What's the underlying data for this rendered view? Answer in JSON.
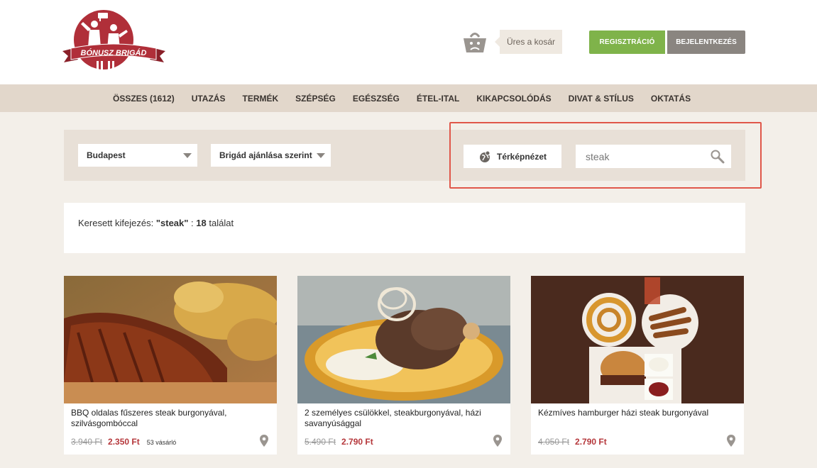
{
  "brand": {
    "logo_text": "BÓNUSZ BRIGÁD",
    "logo_color": "#b02f39"
  },
  "cart": {
    "label": "Üres a kosár",
    "icon": "sad-basket-icon"
  },
  "auth": {
    "register": "REGISZTRÁCIÓ",
    "login": "BEJELENTKEZÉS"
  },
  "nav": {
    "items": [
      "ÖSSZES (1612)",
      "UTAZÁS",
      "TERMÉK",
      "SZÉPSÉG",
      "EGÉSZSÉG",
      "ÉTEL-ITAL",
      "KIKAPCSOLÓDÁS",
      "DIVAT & STÍLUS",
      "OKTATÁS"
    ]
  },
  "filters": {
    "city": "Budapest",
    "sort": "Brigád ajánlása szerint",
    "map_button": "Térképnézet",
    "search_value": "steak",
    "search_icon": "magnifier-icon"
  },
  "results": {
    "prefix": "Keresett kifejezés:",
    "query": "\"steak\"",
    "separator": ":",
    "count": "18",
    "suffix": "találat"
  },
  "cards": [
    {
      "title": "BBQ oldalas fűszeres steak burgonyával, szilvásgombóccal",
      "old_price": "3.940 Ft",
      "new_price": "2.350 Ft",
      "buyers": "53 vásárló"
    },
    {
      "title": "2 személyes csülökkel, steakburgonyával, házi savanyúsággal",
      "old_price": "5.490 Ft",
      "new_price": "2.790 Ft",
      "buyers": ""
    },
    {
      "title": "Kézmíves hamburger házi steak burgonyával",
      "old_price": "4.050 Ft",
      "new_price": "2.790 Ft",
      "buyers": ""
    }
  ],
  "colors": {
    "accent_green": "#7fb34a",
    "accent_gray": "#8a8580",
    "price_red": "#b5373b",
    "highlight_red": "#e0574a"
  }
}
